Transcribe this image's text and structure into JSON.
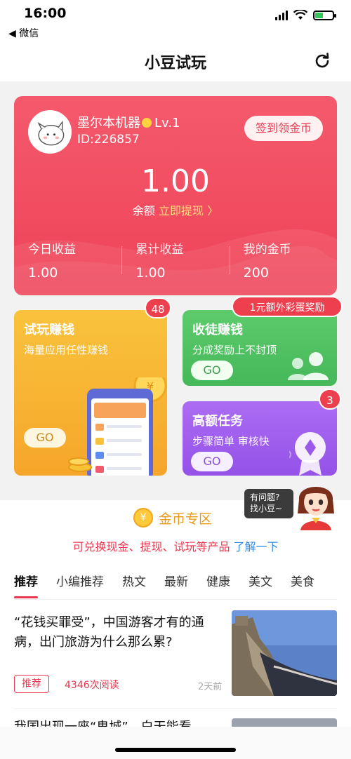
{
  "status_bar": {
    "time": "16:00",
    "back_label": "◀ 微信"
  },
  "nav": {
    "title": "小豆试玩"
  },
  "profile": {
    "name": "墨尔本机器",
    "level": "Lv.1",
    "id_text": "ID:226857",
    "checkin_label": "签到领金币"
  },
  "balance": {
    "amount": "1.00",
    "label": "余额",
    "withdraw_label": "立即提现 〉"
  },
  "stats": [
    {
      "label": "今日收益",
      "value": "1.00"
    },
    {
      "label": "累计收益",
      "value": "1.00"
    },
    {
      "label": "我的金币",
      "value": "200"
    }
  ],
  "cards": {
    "trial": {
      "title": "试玩赚钱",
      "desc": "海量应用任性赚钱",
      "go": "GO",
      "badge": "48"
    },
    "apprentice": {
      "title": "收徒赚钱",
      "desc": "分成奖励上不封顶",
      "go": "GO",
      "badge": "1元额外彩蛋奖励"
    },
    "high": {
      "title": "高额任务",
      "desc": "步骤简单 审核快",
      "go": "GO",
      "badge": "3"
    }
  },
  "helper": {
    "line1": "有问题?",
    "line2": "找小豆~"
  },
  "coin_zone": {
    "title": "金币专区",
    "subtitle": "可兑换现金、提现、试玩等产品",
    "learn_more": "了解一下"
  },
  "tabs": [
    "推荐",
    "小编推荐",
    "热文",
    "最新",
    "健康",
    "美文",
    "美食"
  ],
  "articles": [
    {
      "title": "“花钱买罪受”，中国游客才有的通病，出门旅游为什么那么累?",
      "tag": "推荐",
      "reads": "4346次阅读",
      "time": "2天前"
    },
    {
      "title": "我国出现一座“鬼城”，白天能看"
    }
  ],
  "colors": {
    "primary_red": "#ef4257",
    "accent_gold": "#f5a623",
    "green": "#4cbf5e",
    "purple": "#9b59e6"
  }
}
